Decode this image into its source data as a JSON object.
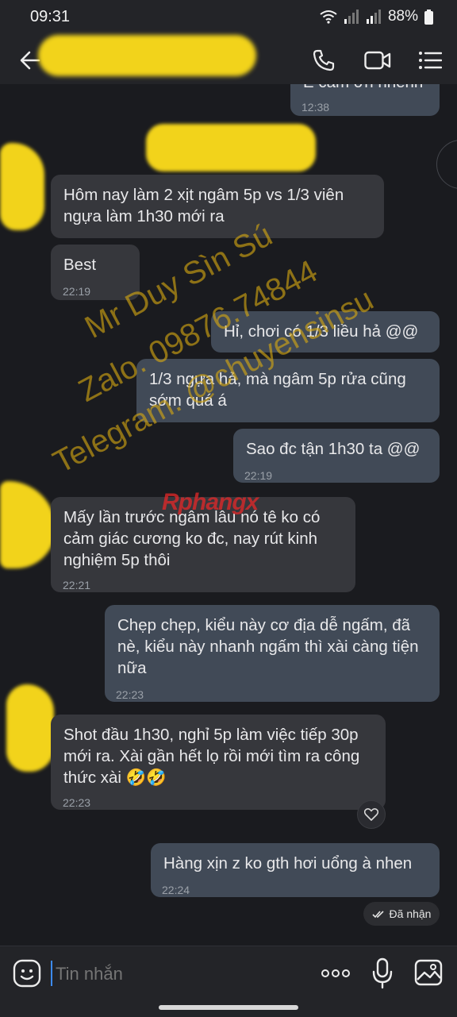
{
  "status": {
    "time": "09:31",
    "battery": "88%"
  },
  "composer": {
    "placeholder": "Tin nhắn"
  },
  "messages": [
    {
      "text": "E cảm ơn nhenh",
      "time": "12:38"
    },
    {
      "text": "Hôm nay làm 2 xịt ngâm 5p vs 1/3 viên ngựa làm 1h30 mới ra"
    },
    {
      "text": "Best",
      "time": "22:19"
    },
    {
      "text": "Hỉ, chơi có 1/3 liều hả @@"
    },
    {
      "text": "1/3 ngựa hả, mà ngâm 5p rửa cũng sớm quá á"
    },
    {
      "text": "Sao đc tận 1h30 ta @@",
      "time": "22:19"
    },
    {
      "text": "Mấy lần trước ngâm lâu nó tê ko có cảm giác cương ko đc, nay rút kinh nghiệm 5p thôi",
      "time": "22:21"
    },
    {
      "text": "Chẹp chẹp, kiểu này cơ địa dễ ngấm, đã nè, kiểu này nhanh ngấm thì xài càng tiện nữa",
      "time": "22:23"
    },
    {
      "text": "Shot đầu 1h30, nghỉ 5p làm việc tiếp 30p mới ra. Xài gần hết lọ rồi mới tìm ra công thức xài 🤣🤣",
      "time": "22:23"
    },
    {
      "text": "Hàng xịn z ko gth hơi uổng à nhen",
      "time": "22:24"
    }
  ],
  "receipt": "Đã nhận",
  "watermark": {
    "line1": "Mr Duy Sìn Sú",
    "line2": "Zalo. 09876.74844",
    "line3": "Telegram. @chuyensinsu",
    "logo": "Rphangx"
  }
}
